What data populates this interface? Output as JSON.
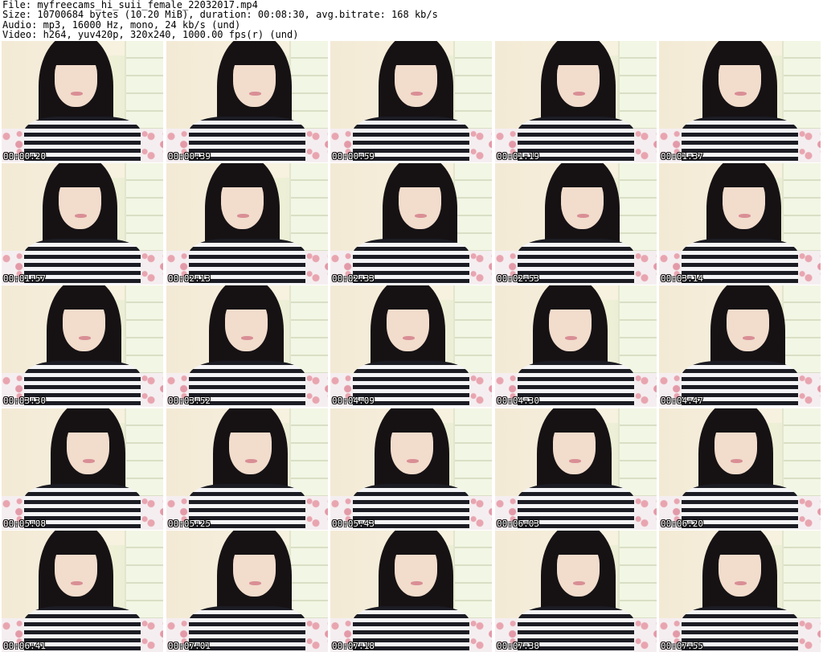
{
  "header": {
    "file_line": "File: myfreecams_hi_suii_female_22032017.mp4",
    "size_line": "Size: 10700684 bytes (10.20 MiB), duration: 00:08:30, avg.bitrate: 168 kb/s",
    "audio_line": "Audio: mp3, 16000 Hz, mono, 24 kb/s (und)",
    "video_line": "Video: h264, yuv420p, 320x240, 1000.00 fps(r) (und)"
  },
  "thumbnails": [
    {
      "timestamp": "00:00:20"
    },
    {
      "timestamp": "00:00:39"
    },
    {
      "timestamp": "00:00:59"
    },
    {
      "timestamp": "00:01:19"
    },
    {
      "timestamp": "00:01:37"
    },
    {
      "timestamp": "00:01:57"
    },
    {
      "timestamp": "00:02:13"
    },
    {
      "timestamp": "00:02:33"
    },
    {
      "timestamp": "00:02:53"
    },
    {
      "timestamp": "00:03:14"
    },
    {
      "timestamp": "00:03:30"
    },
    {
      "timestamp": "00:03:52"
    },
    {
      "timestamp": "00:04:09"
    },
    {
      "timestamp": "00:04:30"
    },
    {
      "timestamp": "00:04:47"
    },
    {
      "timestamp": "00:05:08"
    },
    {
      "timestamp": "00:05:25"
    },
    {
      "timestamp": "00:05:43"
    },
    {
      "timestamp": "00:06:03"
    },
    {
      "timestamp": "00:06:20"
    },
    {
      "timestamp": "00:06:41"
    },
    {
      "timestamp": "00:07:01"
    },
    {
      "timestamp": "00:07:18"
    },
    {
      "timestamp": "00:07:38"
    },
    {
      "timestamp": "00:07:55"
    }
  ],
  "colors": {
    "background": "#ffffff",
    "text": "#000000",
    "timestamp_text": "#ffffff"
  }
}
